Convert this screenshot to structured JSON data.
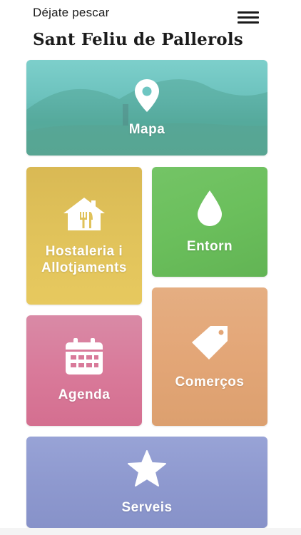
{
  "header": {
    "tagline": "Déjate pescar",
    "title": "Sant Feliu de Pallerols"
  },
  "tiles": {
    "mapa": {
      "label": "Mapa",
      "icon": "map-pin-icon",
      "color": "#6ec6c2"
    },
    "hostaleria": {
      "label": "Hostaleria i\nAllotjaments",
      "icon": "home-cutlery-icon",
      "color": "#e1c35a"
    },
    "entorn": {
      "label": "Entorn",
      "icon": "water-drop-icon",
      "color": "#6bbf5c"
    },
    "agenda": {
      "label": "Agenda",
      "icon": "calendar-icon",
      "color": "#d97a9a"
    },
    "comercos": {
      "label": "Comerços",
      "icon": "tag-icon",
      "color": "#e3a677"
    },
    "serveis": {
      "label": "Serveis",
      "icon": "star-icon",
      "color": "#8e99cf"
    }
  }
}
